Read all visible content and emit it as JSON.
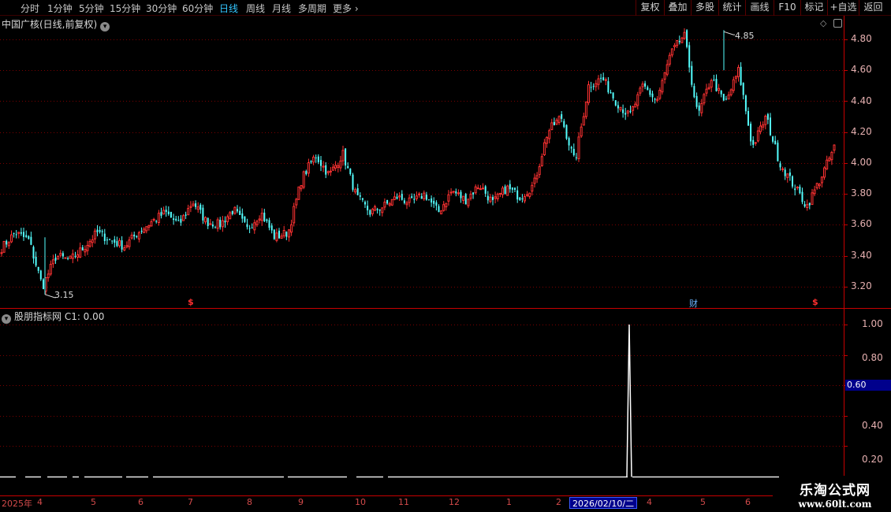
{
  "toolbar": {
    "periods": [
      "分时",
      "1分钟",
      "5分钟",
      "15分钟",
      "30分钟",
      "60分钟",
      "日线",
      "周线",
      "月线",
      "多周期",
      "更多"
    ],
    "active_period": "日线",
    "buttons": [
      "复权",
      "叠加",
      "多股",
      "统计",
      "画线",
      "F10",
      "标记",
      "+自选",
      "返回"
    ]
  },
  "main_chart": {
    "title": "中国广核(日线,前复权)",
    "high_label": "4.85",
    "low_label": "3.15",
    "markers": [
      {
        "label": "$",
        "kind": "s"
      },
      {
        "label": "财",
        "kind": "cai"
      },
      {
        "label": "$",
        "kind": "s"
      }
    ],
    "y_axis_labels": [
      "4.80",
      "4.60",
      "4.40",
      "4.20",
      "4.00",
      "3.80",
      "3.60",
      "3.40",
      "3.20"
    ]
  },
  "indicator": {
    "title": "股朋指标网 C1: 0.00",
    "y_axis_labels": [
      "1.00",
      "0.80",
      "0.40",
      "0.20"
    ],
    "crosshair_value": "0.60"
  },
  "date_axis": {
    "labels": [
      "2025年",
      "4",
      "5",
      "6",
      "7",
      "8",
      "9",
      "10",
      "11",
      "12",
      "1",
      "2",
      "4",
      "5",
      "6"
    ],
    "crosshair_date": "2026/02/10/二"
  },
  "watermark": {
    "title": "乐淘公式网",
    "url": "www.60lt.com"
  },
  "colors": {
    "up": "#ff3232",
    "down": "#54ffff",
    "grid": "#7a0000",
    "axis": "#c80000"
  },
  "chart_data": {
    "type": "candlestick",
    "price_range": [
      3.1,
      4.9
    ],
    "anchor_closes": [
      3.45,
      3.55,
      3.5,
      3.2,
      3.4,
      3.37,
      3.45,
      3.55,
      3.5,
      3.46,
      3.55,
      3.62,
      3.68,
      3.6,
      3.75,
      3.62,
      3.6,
      3.7,
      3.57,
      3.68,
      3.52,
      3.55,
      3.9,
      4.05,
      3.92,
      4.06,
      3.78,
      3.68,
      3.72,
      3.78,
      3.74,
      3.8,
      3.68,
      3.82,
      3.76,
      3.86,
      3.74,
      3.84,
      3.78,
      3.86,
      4.2,
      4.3,
      4.0,
      4.5,
      4.55,
      4.4,
      4.3,
      4.5,
      4.4,
      4.7,
      4.83,
      4.3,
      4.55,
      4.38,
      4.6,
      4.1,
      4.3,
      4.0,
      3.86,
      3.72,
      3.9,
      4.1
    ],
    "indicator_signal_index": 255,
    "indicator_signal_value": 1.0
  }
}
